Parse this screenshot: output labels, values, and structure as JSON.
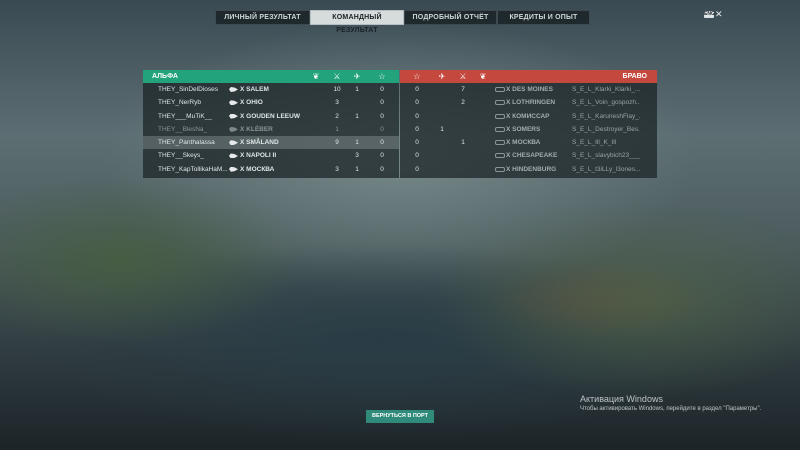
{
  "tabs": [
    {
      "label": "ЛИЧНЫЙ РЕЗУЛЬТАТ",
      "active": false
    },
    {
      "label": "КОМАНДНЫЙ РЕЗУЛЬТАТ",
      "active": true
    },
    {
      "label": "ПОДРОБНЫЙ ОТЧЁТ",
      "active": false
    },
    {
      "label": "КРЕДИТЫ И ОПЫТ",
      "active": false
    }
  ],
  "corner_badge": "ENG",
  "team_left": {
    "name": "АЛЬФА",
    "color": "#23a37b",
    "header_icons": [
      "laurel-icon",
      "crossed-swords-icon",
      "plane-icon",
      "star-icon"
    ],
    "players": [
      {
        "player": "THEY_SinDelDioses",
        "tier": "X",
        "ship": "SALEM",
        "c1": "",
        "c2": "10",
        "c3": "1",
        "c4": "0",
        "selected": false,
        "dead": false
      },
      {
        "player": "THEY_NerRyb",
        "tier": "X",
        "ship": "OHIO",
        "c1": "",
        "c2": "3",
        "c3": "",
        "c4": "0",
        "selected": false,
        "dead": false
      },
      {
        "player": "THEY___MuTiK__",
        "tier": "X",
        "ship": "GOUDEN LEEUW",
        "c1": "",
        "c2": "2",
        "c3": "1",
        "c4": "0",
        "selected": false,
        "dead": false
      },
      {
        "player": "THEY__BlesNa_",
        "tier": "X",
        "ship": "KLÉBER",
        "c1": "",
        "c2": "1",
        "c3": "",
        "c4": "0",
        "selected": false,
        "dead": true
      },
      {
        "player": "THEY_Panthalassa",
        "tier": "X",
        "ship": "SMÅLAND",
        "c1": "",
        "c2": "9",
        "c3": "1",
        "c4": "0",
        "selected": true,
        "dead": false
      },
      {
        "player": "THEY__Skeys_",
        "tier": "X",
        "ship": "NAPOLI II",
        "c1": "",
        "c2": "",
        "c3": "3",
        "c4": "0",
        "selected": false,
        "dead": false
      },
      {
        "player": "THEY_KapTollikaHaM...",
        "tier": "X",
        "ship": "МОСКВА",
        "c1": "",
        "c2": "3",
        "c3": "1",
        "c4": "0",
        "selected": false,
        "dead": false
      }
    ]
  },
  "team_right": {
    "name": "БРАВО",
    "color": "#c4483d",
    "header_icons": [
      "star-icon",
      "plane-icon",
      "crossed-swords-icon",
      "laurel-icon"
    ],
    "players": [
      {
        "c4": "0",
        "c3": "",
        "c2": "7",
        "c1": "",
        "tier": "X",
        "ship": "DES MOINES",
        "player": "S_E_L_Klarki_Klarki_..."
      },
      {
        "c4": "0",
        "c3": "",
        "c2": "2",
        "c1": "",
        "tier": "X",
        "ship": "LOTHRINGEN",
        "player": "S_E_L_Voin_gospozh..."
      },
      {
        "c4": "0",
        "c3": "",
        "c2": "",
        "c1": "",
        "tier": "X",
        "ship": "КОМИССАР",
        "player": "S_E_L_KaruneshFlay_..."
      },
      {
        "c4": "0",
        "c3": "1",
        "c2": "",
        "c1": "",
        "tier": "X",
        "ship": "SOMERS",
        "player": "S_E_L_Destroyer_Bes..."
      },
      {
        "c4": "0",
        "c3": "",
        "c2": "1",
        "c1": "",
        "tier": "X",
        "ship": "МОСКВА",
        "player": "S_E_L_Ill_K_Ill"
      },
      {
        "c4": "0",
        "c3": "",
        "c2": "",
        "c1": "",
        "tier": "X",
        "ship": "CHESAPEAKE",
        "player": "S_E_L_slavybich23___"
      },
      {
        "c4": "0",
        "c3": "",
        "c2": "",
        "c1": "",
        "tier": "X",
        "ship": "HINDENBURG",
        "player": "S_E_L_t3iLLy_l3ones..."
      }
    ]
  },
  "return_button": "ВЕРНУТЬСЯ В ПОРТ",
  "watermark": {
    "title": "Активация Windows",
    "subtitle": "Чтобы активировать Windows, перейдите в раздел \"Параметры\"."
  }
}
